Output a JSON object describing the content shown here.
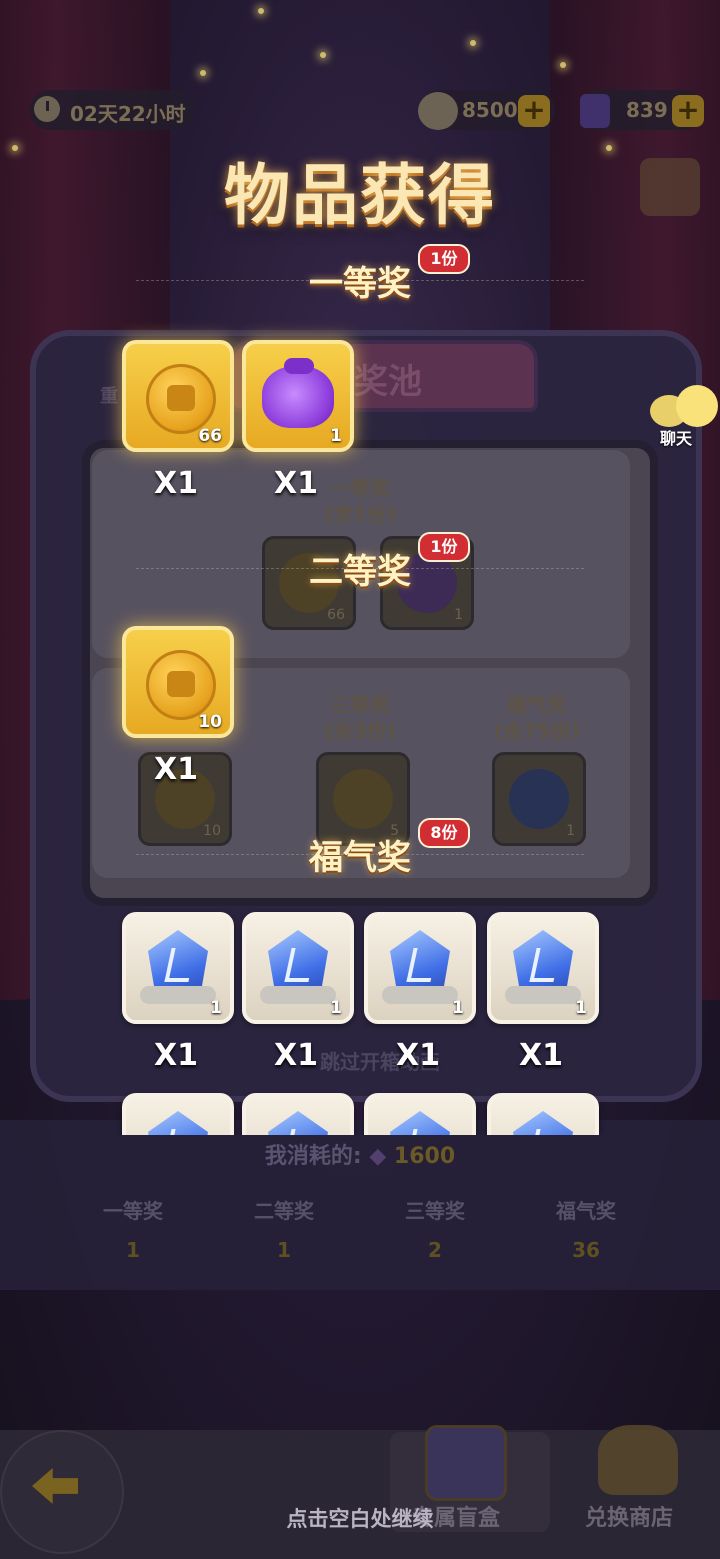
{
  "hud": {
    "timer": "02天22小时",
    "currency1": "8500",
    "currency2": "839",
    "plus": "+"
  },
  "background": {
    "pool_tab": "奖池",
    "pool_tab_prefix": "重",
    "dim_first_prize": "一等奖",
    "dim_first_remaining": "(余1份)",
    "dim_item_counts": [
      "66",
      "1"
    ],
    "dim_third_prize": "三等奖",
    "dim_third_remaining": "(余3份)",
    "dim_blessing_prize": "福气奖",
    "dim_blessing_remaining": "(余75份)",
    "dim_row2_counts": [
      "10",
      "5",
      "1"
    ],
    "skip_animation": "跳过开箱动画",
    "consume_label": "我消耗的:",
    "consume_value": "1600",
    "stats": [
      {
        "label": "一等奖",
        "value": "1"
      },
      {
        "label": "二等奖",
        "value": "1"
      },
      {
        "label": "三等奖",
        "value": "2"
      },
      {
        "label": "福气奖",
        "value": "36"
      }
    ]
  },
  "chat": {
    "label": "聊天"
  },
  "overlay": {
    "title": "物品获得",
    "sections": [
      {
        "name": "一等奖",
        "badge": "1份",
        "items": [
          {
            "icon": "gold-coin-icon",
            "count": "66",
            "qty": "X1",
            "frame": "gold"
          },
          {
            "icon": "purple-bag-icon",
            "count": "1",
            "qty": "X1",
            "frame": "gold"
          }
        ]
      },
      {
        "name": "二等奖",
        "badge": "1份",
        "items": [
          {
            "icon": "gold-coin-icon",
            "count": "10",
            "qty": "X1",
            "frame": "gold"
          }
        ]
      },
      {
        "name": "福气奖",
        "badge": "8份",
        "items": [
          {
            "icon": "blue-crystal-icon",
            "count": "1",
            "qty": "X1",
            "frame": "silver"
          },
          {
            "icon": "blue-crystal-icon",
            "count": "1",
            "qty": "X1",
            "frame": "silver"
          },
          {
            "icon": "blue-crystal-icon",
            "count": "1",
            "qty": "X1",
            "frame": "silver"
          },
          {
            "icon": "blue-crystal-icon",
            "count": "1",
            "qty": "X1",
            "frame": "silver"
          }
        ]
      }
    ],
    "continue_hint": "点击空白处继续"
  },
  "bottom": {
    "blind_box": "专属盲盒",
    "exchange_shop": "兑换商店"
  }
}
